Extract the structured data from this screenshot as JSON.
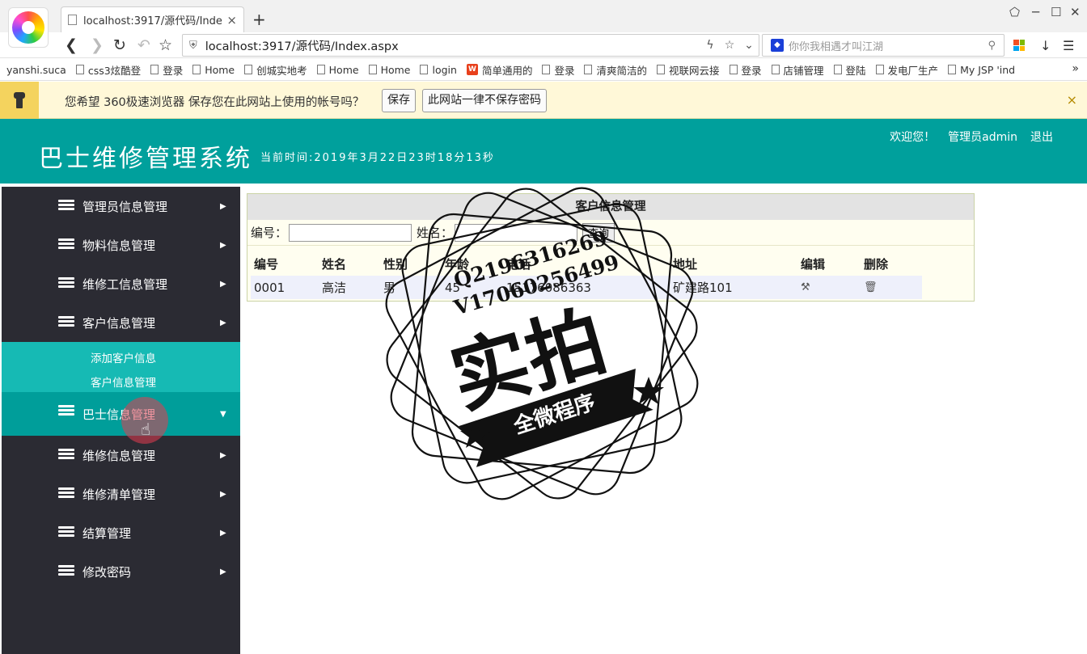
{
  "browser": {
    "tab_title": "localhost:3917/源代码/Index.a",
    "tab_close": "×",
    "new_tab": "+",
    "address": "localhost:3917/源代码/Index.aspx",
    "search_placeholder": "你你我相遇才叫江湖",
    "bookmarks": [
      "yanshi.suca",
      "css3炫酷登",
      "登录",
      "Home",
      "创城实地考",
      "Home",
      "Home",
      "login",
      "简单通用的",
      "登录",
      "清爽简洁的",
      "视联网云接",
      "登录",
      "店铺管理",
      "登陆",
      "发电厂生产",
      "My JSP 'ind"
    ],
    "bookmark_more": "»"
  },
  "password_bar": {
    "message": "您希望 360极速浏览器 保存您在此网站上使用的帐号吗？",
    "save": "保存",
    "never": "此网站一律不保存密码",
    "close": "×"
  },
  "header": {
    "title": "巴士维修管理系统",
    "time": "当前时间:2019年3月22日23时18分13秒",
    "welcome": "欢迎您！",
    "user": "管理员admin",
    "logout": "退出"
  },
  "sidebar": {
    "items": [
      {
        "label": "管理员信息管理",
        "arrow": "▶"
      },
      {
        "label": "物料信息管理",
        "arrow": "▶"
      },
      {
        "label": "维修工信息管理",
        "arrow": "▶"
      },
      {
        "label": "客户信息管理",
        "arrow": "▶"
      },
      {
        "label": "巴士信息管理",
        "arrow": "▼"
      },
      {
        "label": "维修信息管理",
        "arrow": "▶"
      },
      {
        "label": "维修清单管理",
        "arrow": "▶"
      },
      {
        "label": "结算管理",
        "arrow": "▶"
      },
      {
        "label": "修改密码",
        "arrow": "▶"
      }
    ],
    "submenu": [
      "添加客户信息",
      "客户信息管理"
    ]
  },
  "main": {
    "title": "客户信息管理",
    "id_label": "编号：",
    "name_label": "姓名：",
    "query": "查询",
    "columns": [
      "编号",
      "姓名",
      "性别",
      "年龄",
      "电话",
      "地址",
      "编辑",
      "删除"
    ],
    "rows": [
      {
        "id": "0001",
        "name": "高洁",
        "gender": "男",
        "age": "45",
        "phone": "15176086363",
        "address": "矿建路101"
      }
    ]
  },
  "watermark": {
    "line1": "Q2196316269",
    "line2": "V17060256499",
    "big": "实拍",
    "ribbon": "全微程序"
  },
  "colors": {
    "header_bg": "#00a09c",
    "sidebar_bg": "#2b2b33",
    "submenu_bg": "#16bab4",
    "active_item_bg": "#009e9a"
  }
}
